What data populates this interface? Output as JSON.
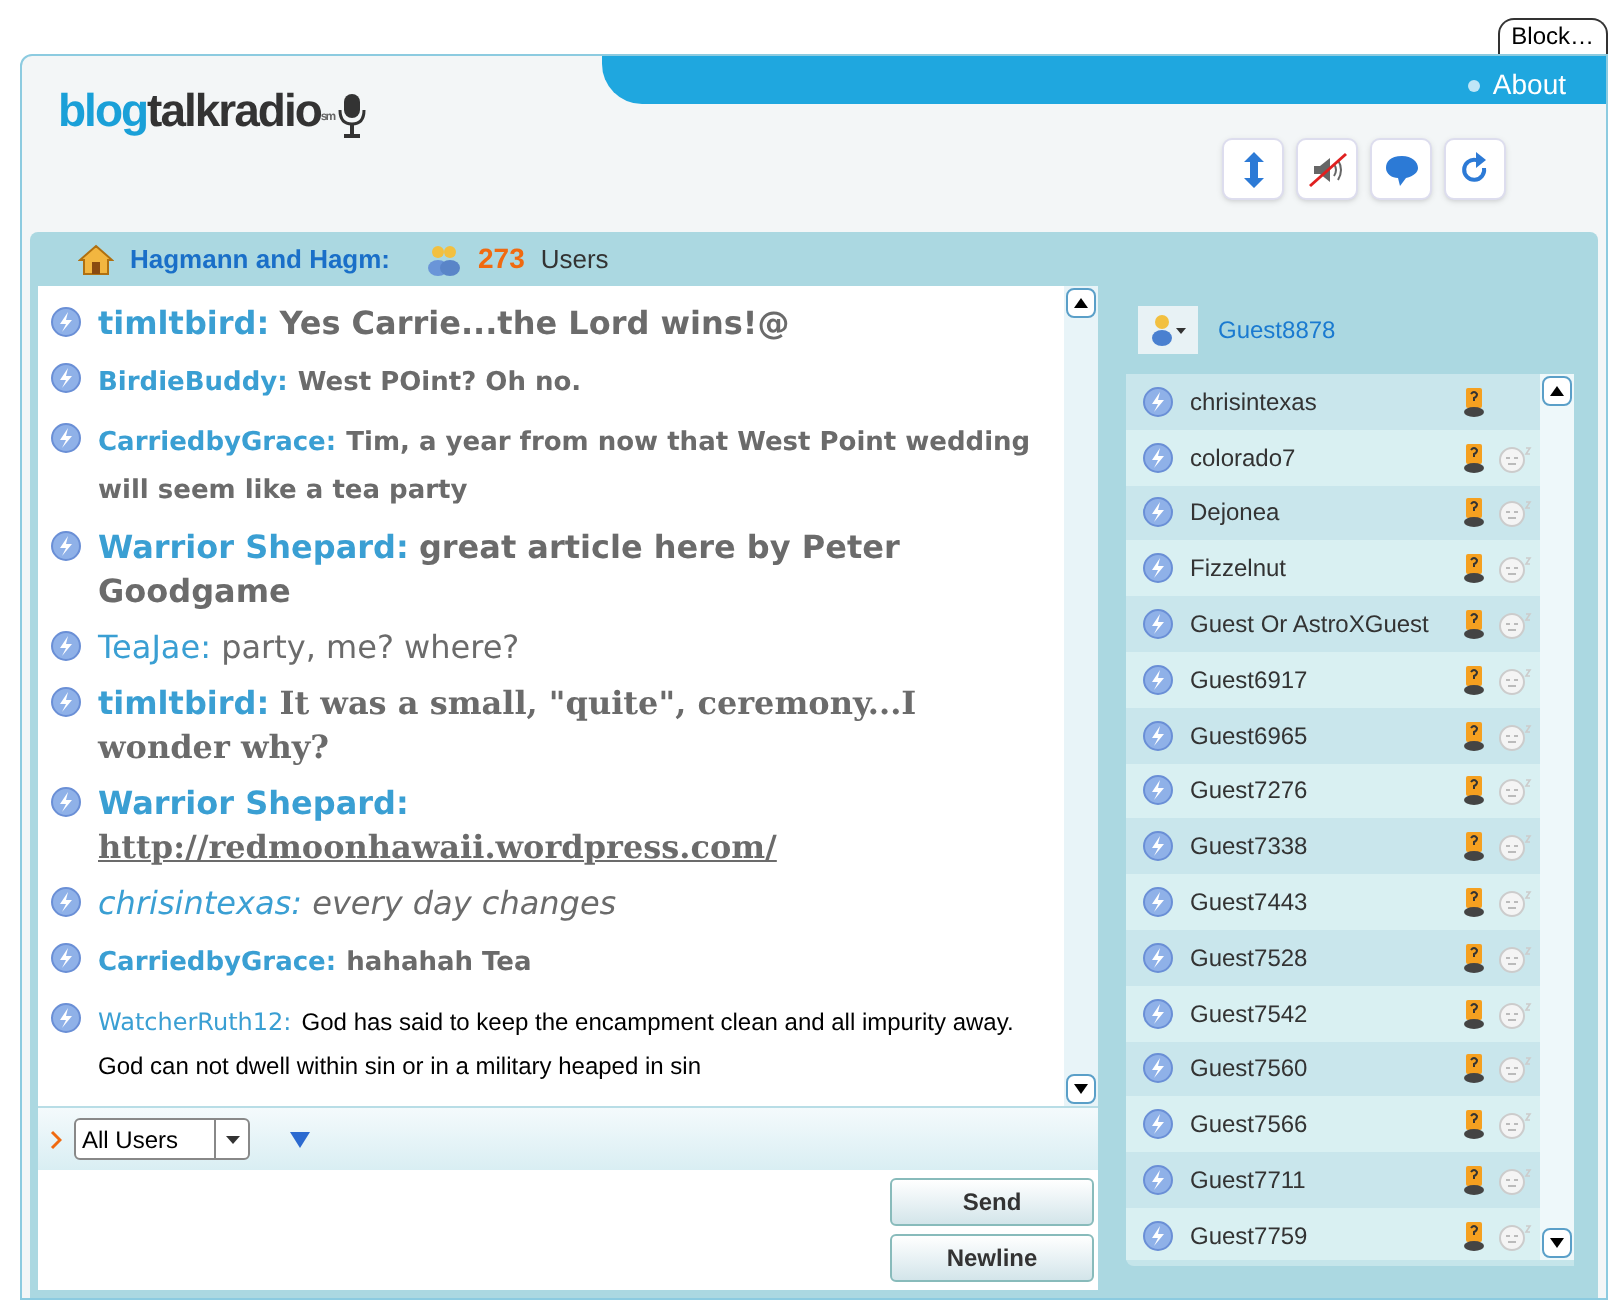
{
  "block_tab": "Block…",
  "logo": {
    "part1": "blog",
    "part2": "talkradio",
    "mark": "sm"
  },
  "about_link": "About",
  "show_title": "Hagmann and Hagm:",
  "user_count": "273",
  "users_label": "Users",
  "messages": [
    {
      "kind": "large",
      "user": "timltbird:",
      "text": "Yes Carrie...the Lord wins!@"
    },
    {
      "kind": "medium",
      "user": "BirdieBuddy:",
      "text": "West POint? Oh no."
    },
    {
      "kind": "medium",
      "user": "CarriedbyGrace:",
      "text": "Tim, a year from now that West Point wedding will seem like a tea party"
    },
    {
      "kind": "large",
      "user": "Warrior Shepard:",
      "text": "great article here by Peter Goodgame"
    },
    {
      "kind": "plain",
      "user": "TeaJae:",
      "text": "party, me?  where?"
    },
    {
      "kind": "serif",
      "user": "timltbird:",
      "text": "It was a small, \"quite\", ceremony...I wonder why?"
    },
    {
      "kind": "link",
      "user": "Warrior Shepard:",
      "text": "http://redmoonhawaii.wordpress.com/"
    },
    {
      "kind": "cursive",
      "user": "chrisintexas:",
      "text": "every day changes"
    },
    {
      "kind": "medium",
      "user": "CarriedbyGrace:",
      "text": "hahahah  Tea"
    },
    {
      "kind": "small",
      "user": "WatcherRuth12:",
      "text": "God has said to keep the encampment clean and all impurity away. God can not dwell within sin or in a military heaped in sin"
    }
  ],
  "recipient_select": "All Users",
  "send_button": "Send",
  "newline_button": "Newline",
  "current_user": "Guest8878",
  "users": [
    {
      "name": "chrisintexas",
      "idle": false
    },
    {
      "name": "colorado7",
      "idle": true
    },
    {
      "name": "Dejonea",
      "idle": true
    },
    {
      "name": "Fizzelnut",
      "idle": true
    },
    {
      "name": "Guest Or AstroXGuest",
      "idle": true
    },
    {
      "name": "Guest6917",
      "idle": true
    },
    {
      "name": "Guest6965",
      "idle": true
    },
    {
      "name": "Guest7276",
      "idle": true
    },
    {
      "name": "Guest7338",
      "idle": true
    },
    {
      "name": "Guest7443",
      "idle": true
    },
    {
      "name": "Guest7528",
      "idle": true
    },
    {
      "name": "Guest7542",
      "idle": true
    },
    {
      "name": "Guest7560",
      "idle": true
    },
    {
      "name": "Guest7566",
      "idle": true
    },
    {
      "name": "Guest7711",
      "idle": true
    },
    {
      "name": "Guest7759",
      "idle": true
    }
  ]
}
